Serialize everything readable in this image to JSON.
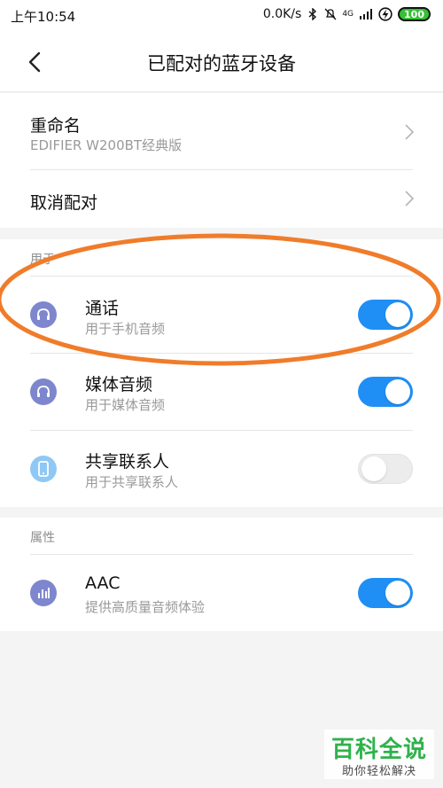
{
  "status_bar": {
    "time": "上午10:54",
    "net_speed": "0.0K/s",
    "signal_label": "4G",
    "battery": "100"
  },
  "header": {
    "title": "已配对的蓝牙设备"
  },
  "device_section": {
    "rename": {
      "label": "重命名",
      "value": "EDIFIER W200BT经典版"
    },
    "unpair": {
      "label": "取消配对"
    }
  },
  "usage_section": {
    "label": "用于",
    "items": [
      {
        "title": "通话",
        "subtitle": "用于手机音频",
        "enabled": true,
        "icon": "headphones-icon",
        "icon_color": "#7e87cd"
      },
      {
        "title": "媒体音频",
        "subtitle": "用于媒体音频",
        "enabled": true,
        "icon": "headphones-icon",
        "icon_color": "#7e87cd"
      },
      {
        "title": "共享联系人",
        "subtitle": "用于共享联系人",
        "enabled": false,
        "icon": "phone-icon",
        "icon_color": "#8fc8f5"
      }
    ]
  },
  "property_section": {
    "label": "属性",
    "items": [
      {
        "title": "AAC",
        "subtitle": "提供高质量音频体验",
        "enabled": true,
        "icon": "bar-chart-icon",
        "icon_color": "#7e87cd"
      }
    ]
  },
  "colors": {
    "toggle_on": "#1f8ff5",
    "annotation": "#f07c2a",
    "watermark": "#2fb24b"
  },
  "watermark": {
    "line1": "百科全说",
    "line2": "助你轻松解决"
  }
}
